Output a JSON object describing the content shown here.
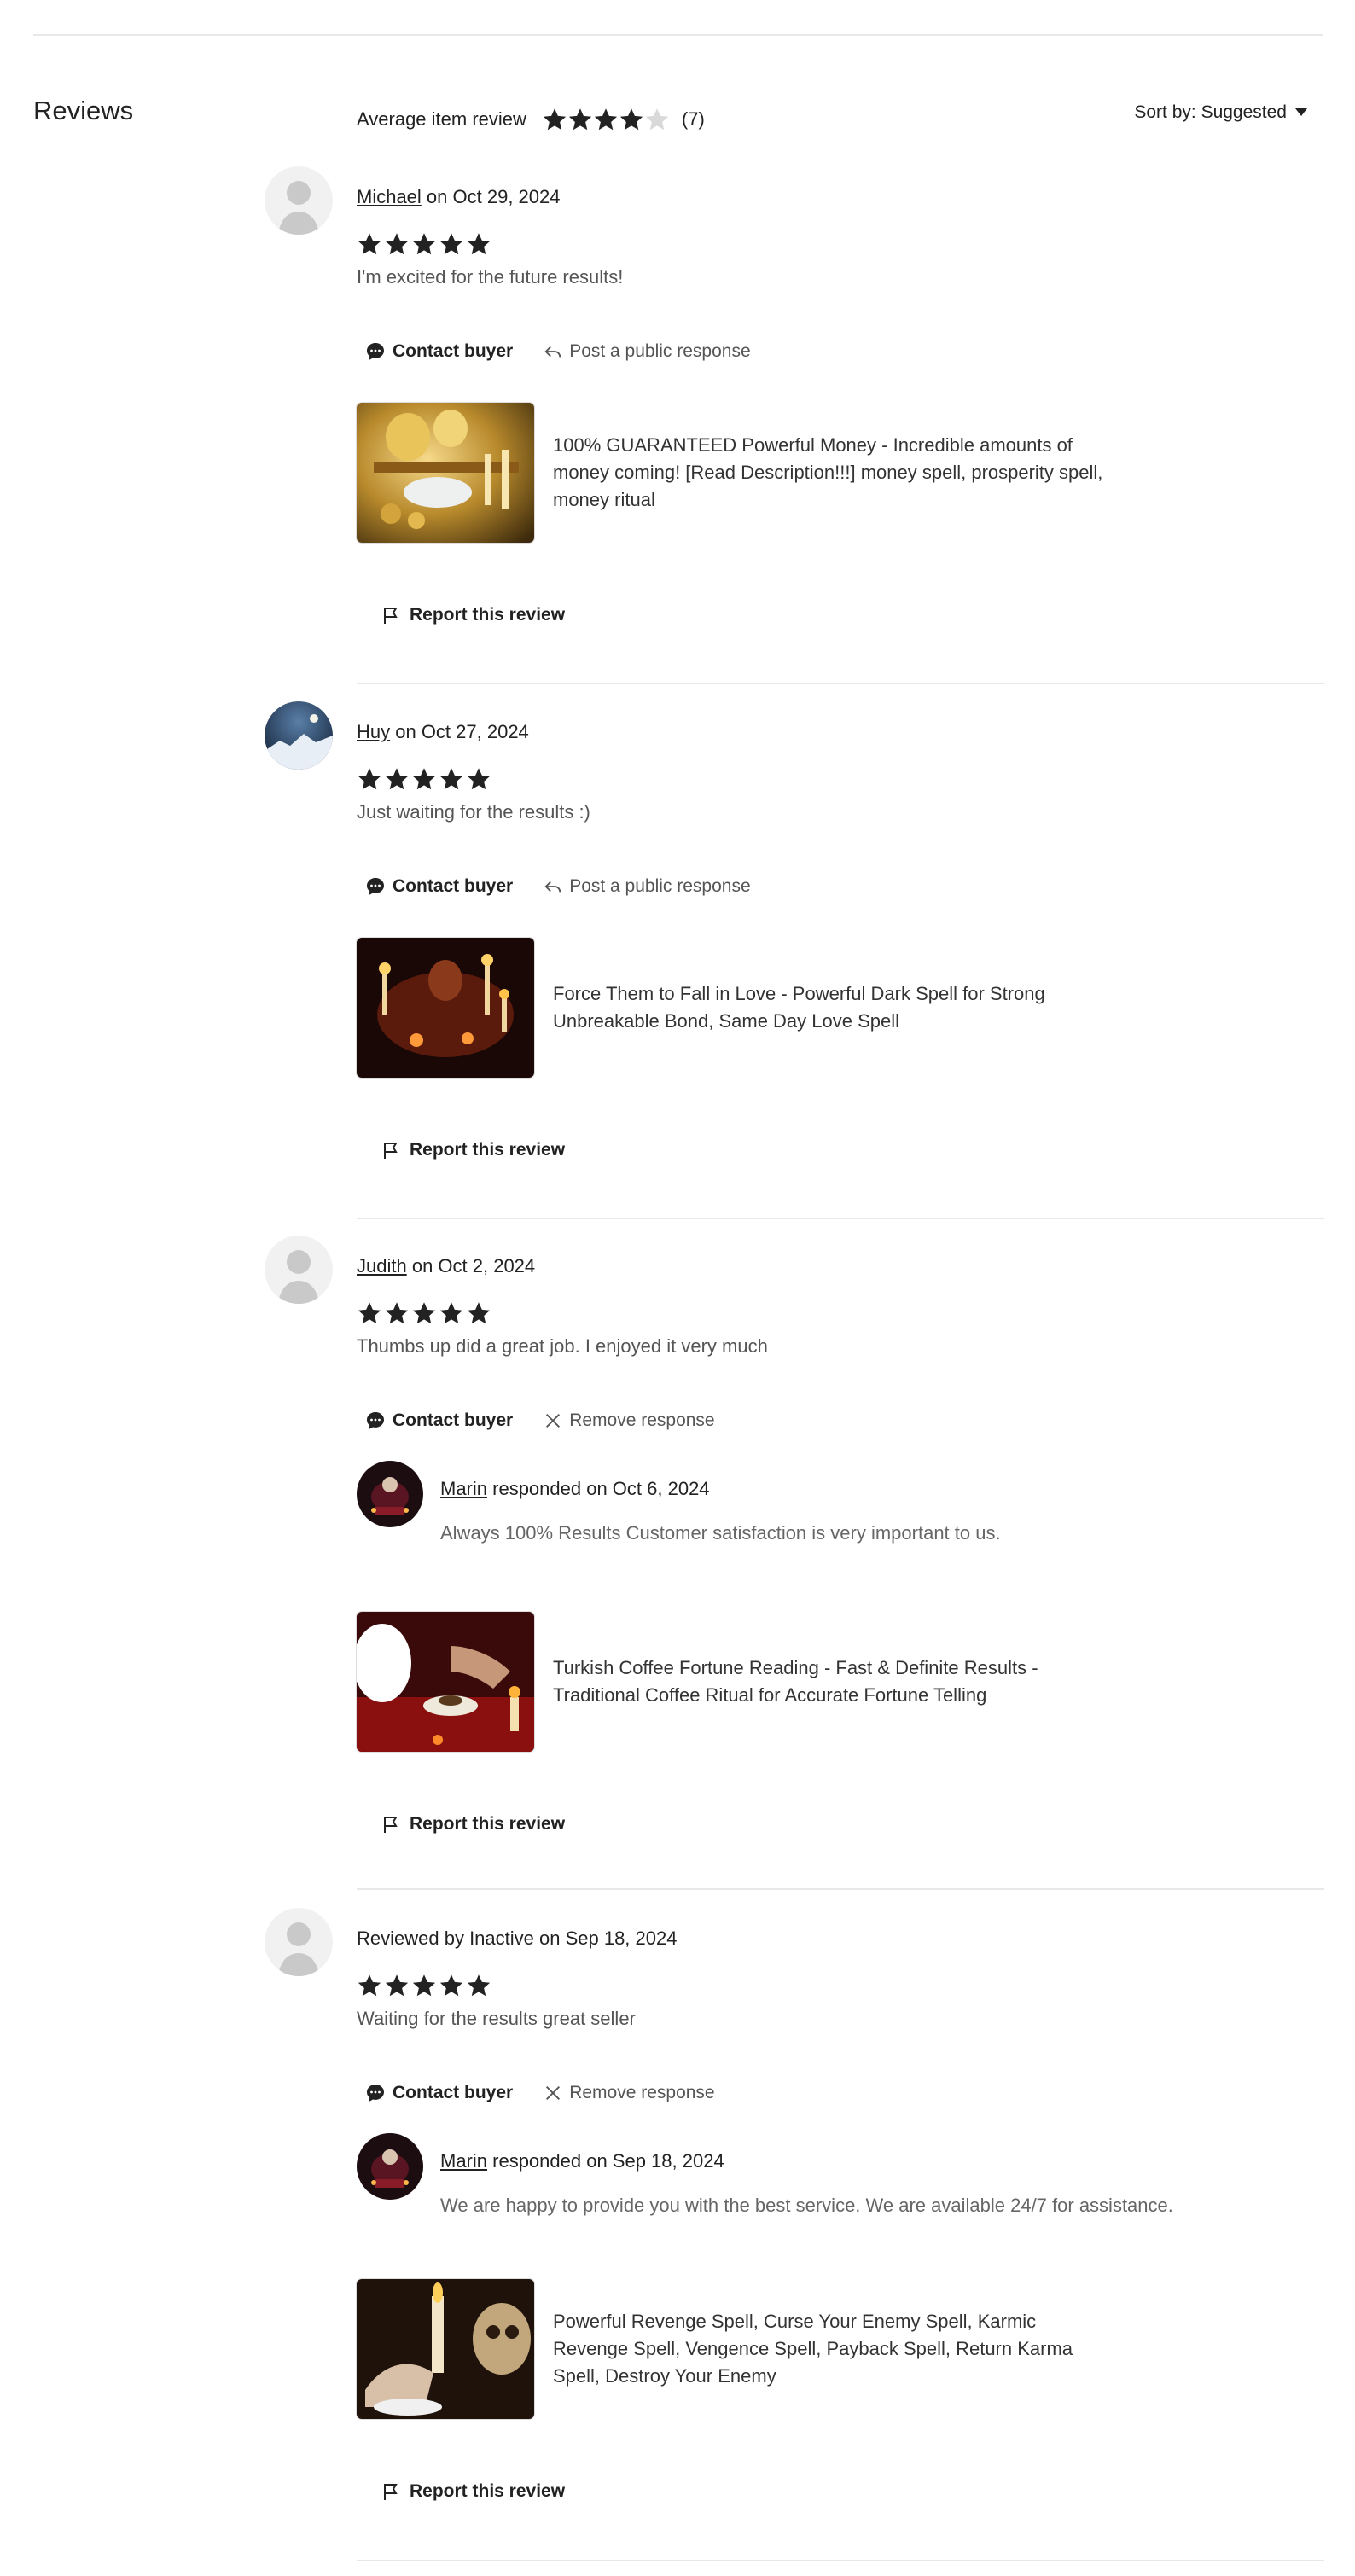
{
  "header": {
    "title": "Reviews"
  },
  "summary": {
    "label": "Average item review",
    "rating": 4,
    "max_rating": 5,
    "count": "(7)"
  },
  "sort": {
    "label": "Sort by: Suggested"
  },
  "actions": {
    "contact": "Contact buyer",
    "public_response": "Post a public response",
    "remove_response": "Remove response",
    "report": "Report this review"
  },
  "reviews": [
    {
      "user": "Michael",
      "date_text": " on Oct 29, 2024",
      "rating": 5,
      "text": "I'm excited for the future results!",
      "listing": "100% GUARANTEED Powerful Money - Incredible amounts of money coming! [Read Description!!!] money spell, prosperity spell, money ritual",
      "avatar": "default-avatar"
    },
    {
      "user": "Huy",
      "date_text": " on Oct 27, 2024",
      "rating": 5,
      "text": "Just waiting for the results :)",
      "listing": "Force Them to Fall in Love - Powerful Dark Spell for Strong Unbreakable Bond, Same Day Love Spell",
      "avatar": "moon-photo"
    },
    {
      "user": "Judith",
      "date_text": " on Oct 2, 2024",
      "rating": 5,
      "text": "Thumbs up did a great job. I enjoyed it very much",
      "response": {
        "user": "Marin",
        "date_text": " responded on Oct 6, 2024",
        "message": "Always 100% Results Customer satisfaction is very important to us."
      },
      "listing": "Turkish Coffee Fortune Reading - Fast & Definite Results - Traditional Coffee Ritual for Accurate Fortune Telling",
      "avatar": "default-avatar"
    },
    {
      "byline": "Reviewed by Inactive on Sep 18, 2024",
      "rating": 5,
      "text": "Waiting for the results great seller",
      "response": {
        "user": "Marin",
        "date_text": " responded on Sep 18, 2024",
        "message": "We are happy to provide you with the best service. We are available 24/7 for assistance."
      },
      "listing": "Powerful Revenge Spell, Curse Your Enemy Spell, Karmic Revenge Spell, Vengence Spell, Payback Spell, Return Karma Spell, Destroy Your Enemy",
      "avatar": "default-avatar"
    }
  ],
  "colors": {
    "star": "#222222",
    "star_empty": "#d9d9d9",
    "divider": "#e8e8e8",
    "muted_text": "#555555"
  }
}
